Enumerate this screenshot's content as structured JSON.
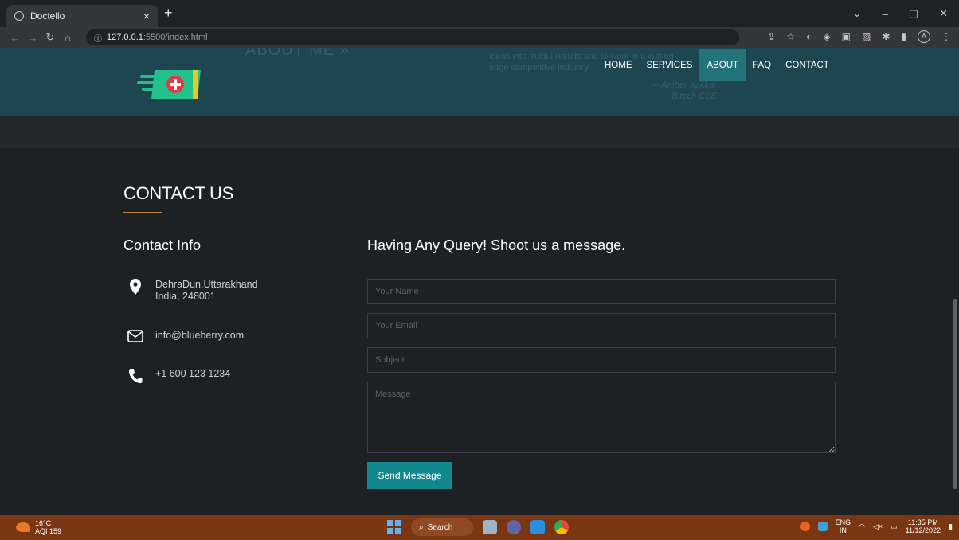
{
  "browser": {
    "tab_title": "Doctello",
    "tab_close": "×",
    "new_tab": "+",
    "url_host": "127.0.0.1",
    "url_path": ":5500/index.html",
    "avatar_letter": "A"
  },
  "header": {
    "ghost_about": "ABOUT ME »",
    "ghost_quote": "ideas into fruitful results and to work in a cutting edge competitive industry",
    "ghost_author": "— Amber Kakkar B.tech CSE",
    "nav": [
      {
        "label": "HOME",
        "active": false
      },
      {
        "label": "SERVICES",
        "active": false
      },
      {
        "label": "ABOUT",
        "active": true
      },
      {
        "label": "FAQ",
        "active": false
      },
      {
        "label": "CONTACT",
        "active": false
      }
    ]
  },
  "contact": {
    "title": "CONTACT US",
    "info_title": "Contact Info",
    "address_line1": "DehraDun,Uttarakhand",
    "address_line2": "India, 248001",
    "email": "info@blueberry.com",
    "phone": "+1 600 123 1234",
    "form_title": "Having Any Query! Shoot us a message.",
    "name_placeholder": "Your Name",
    "email_placeholder": "Your Email",
    "subject_placeholder": "Subject",
    "message_placeholder": "Message",
    "send_label": "Send Message"
  },
  "taskbar": {
    "temperature": "16°C",
    "aqi": "AQI 159",
    "search_label": "Search",
    "lang_line1": "ENG",
    "lang_line2": "IN",
    "time": "11:35 PM",
    "date": "11/12/2022"
  },
  "colors": {
    "accent_teal": "#12878e",
    "underline_orange": "#c9822c",
    "header_bg": "#1d4650",
    "taskbar_bg": "#7a3512"
  }
}
